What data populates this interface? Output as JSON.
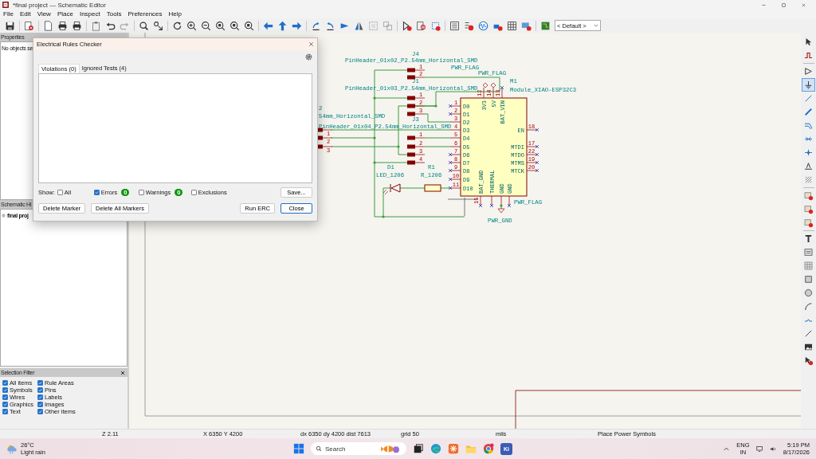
{
  "window": {
    "title": "*final project — Schematic Editor"
  },
  "menu": [
    "File",
    "Edit",
    "View",
    "Place",
    "Inspect",
    "Tools",
    "Preferences",
    "Help"
  ],
  "toolbar": {
    "dropdown": "< Default >"
  },
  "properties_panel": {
    "title": "Properties",
    "text": "No objects se"
  },
  "hierarchy_panel": {
    "title": "Schematic Hi",
    "items": [
      "final proj"
    ]
  },
  "selection_filter": {
    "title": "Selection Filter",
    "items": [
      {
        "label": "All items",
        "checked": true
      },
      {
        "label": "Symbols",
        "checked": true
      },
      {
        "label": "Wires",
        "checked": true
      },
      {
        "label": "Graphics",
        "checked": true
      },
      {
        "label": "Text",
        "checked": true
      },
      {
        "label": "Rule Areas",
        "checked": true
      },
      {
        "label": "Pins",
        "checked": true
      },
      {
        "label": "Labels",
        "checked": true
      },
      {
        "label": "Images",
        "checked": true
      },
      {
        "label": "Other items",
        "checked": true
      }
    ]
  },
  "schematic": {
    "symbols": [
      {
        "ref": "J4",
        "value": "PinHeader_01x02_P2.54mm_Horizontal_SMD",
        "pins": [
          "1",
          "2"
        ]
      },
      {
        "ref": "J1",
        "value": "PinHeader_01x03_P2.54mm_Horizontal_SMD",
        "pins": [
          "1",
          "2",
          "3"
        ]
      },
      {
        "ref": "2",
        "value": "54mm_Horizontal_SMD",
        "pins": [
          "1",
          "2",
          "3"
        ]
      },
      {
        "ref": "J3",
        "value": "PinHeader_01x04_P2.54mm_Horizontal_SMD",
        "pins": [
          "1",
          "2",
          "3",
          "4"
        ]
      },
      {
        "ref": "D1",
        "value": "LED_1206"
      },
      {
        "ref": "R1",
        "value": "R_1206"
      }
    ],
    "module": {
      "ref": "M1",
      "value": "Module_XIAO-ESP32C3",
      "left_pins": [
        {
          "name": "D0",
          "number": "1"
        },
        {
          "name": "D1",
          "number": "2"
        },
        {
          "name": "D2",
          "number": "3"
        },
        {
          "name": "D3",
          "number": "4"
        },
        {
          "name": "D4",
          "number": "5"
        },
        {
          "name": "D5",
          "number": "6"
        },
        {
          "name": "D6",
          "number": "7"
        },
        {
          "name": "D7",
          "number": "8"
        },
        {
          "name": "D8",
          "number": "9"
        },
        {
          "name": "D9",
          "number": "10"
        },
        {
          "name": "D10",
          "number": "11"
        }
      ],
      "right_pins": [
        {
          "name": "EN",
          "number": "18"
        },
        {
          "name": "MTDI",
          "number": "17"
        },
        {
          "name": "MTDO",
          "number": "22"
        },
        {
          "name": "MTMS",
          "number": "19"
        },
        {
          "name": "MTCK",
          "number": "20"
        }
      ],
      "top_pins": [
        {
          "name": "3V3",
          "number": "12"
        },
        {
          "name": "5V",
          "number": "14"
        },
        {
          "name": "BAT_VIN",
          "number": "13"
        }
      ],
      "bottom_pins": [
        {
          "name": "BAT_GND",
          "number": "15"
        },
        {
          "name": "THERMAL"
        },
        {
          "name": "GND"
        },
        {
          "name": "GND"
        }
      ]
    },
    "power": [
      "PWR_FLAG",
      "PWR_FLAG",
      "PWR_FLAG",
      "PWR_GND"
    ]
  },
  "right_tools": [
    {
      "selected": false
    },
    {
      "selected": false
    },
    {
      "selected": false
    },
    {
      "selected": true
    },
    {
      "selected": false
    },
    {
      "selected": false
    },
    {
      "selected": false
    },
    {
      "selected": false
    },
    {
      "selected": false
    },
    {
      "selected": false
    },
    {
      "selected": false
    },
    {
      "selected": false
    },
    {
      "selected": false
    },
    {
      "selected": false
    },
    {
      "selected": false
    },
    {
      "selected": false
    },
    {
      "selected": false
    },
    {
      "selected": false
    },
    {
      "selected": false
    },
    {
      "selected": false
    },
    {
      "selected": false
    },
    {
      "selected": false
    },
    {
      "selected": false
    },
    {
      "selected": false
    }
  ],
  "erc": {
    "title": "Electrical Rules Checker",
    "tabs": [
      {
        "label": "Violations (0)",
        "selected": true
      },
      {
        "label": "Ignored Tests (4)",
        "selected": false
      }
    ],
    "show_label": "Show:",
    "filters": [
      {
        "label": "All",
        "checked": false
      },
      {
        "label": "Errors",
        "checked": true,
        "count": "0"
      },
      {
        "label": "Warnings",
        "checked": false,
        "count": "0"
      },
      {
        "label": "Exclusions",
        "checked": false
      }
    ],
    "save_button": "Save...",
    "left_buttons": [
      "Delete Marker",
      "Delete All Markers"
    ],
    "right_buttons": [
      {
        "label": "Run ERC",
        "default": false
      },
      {
        "label": "Close",
        "default": true
      }
    ]
  },
  "status_bar": [
    "Z 2.11",
    "X 6350  Y 4200",
    "dx 6350  dy 4200  dist 7613",
    "grid 50",
    "mils",
    "Place Power Symbols"
  ],
  "taskbar": {
    "weather": {
      "temp": "26°C",
      "text": "Light rain"
    },
    "search": {
      "placeholder": "Search"
    },
    "app_label": "Ki",
    "tray": {
      "lang": "ENG",
      "region": "IN",
      "time": "5:19 PM",
      "date": "8/17/2026"
    }
  }
}
